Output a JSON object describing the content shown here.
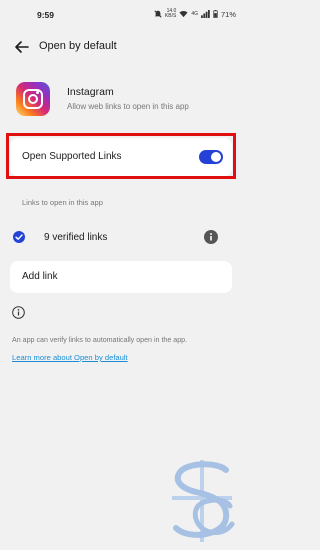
{
  "status_bar": {
    "time": "9:59",
    "network_speed_value": "14.0",
    "network_speed_unit": "KB/S",
    "network_type": "4G",
    "battery": "71%"
  },
  "header": {
    "title": "Open by default",
    "back_icon": "arrow-left-icon"
  },
  "app": {
    "name": "Instagram",
    "description": "Allow web links to open in this app",
    "icon": "instagram-logo"
  },
  "supported_links": {
    "label": "Open Supported Links",
    "enabled": true,
    "toggle_color": "#2443d6"
  },
  "links_section": {
    "label": "Links to open in this app",
    "verified_label": "9 verified links",
    "add_link_label": "Add link"
  },
  "footer": {
    "description": "An app can verify links to automatically open in the app.",
    "learn_more": "Learn more about Open by default",
    "link_color": "#1b8fd6"
  },
  "highlight_color": "#e01010"
}
